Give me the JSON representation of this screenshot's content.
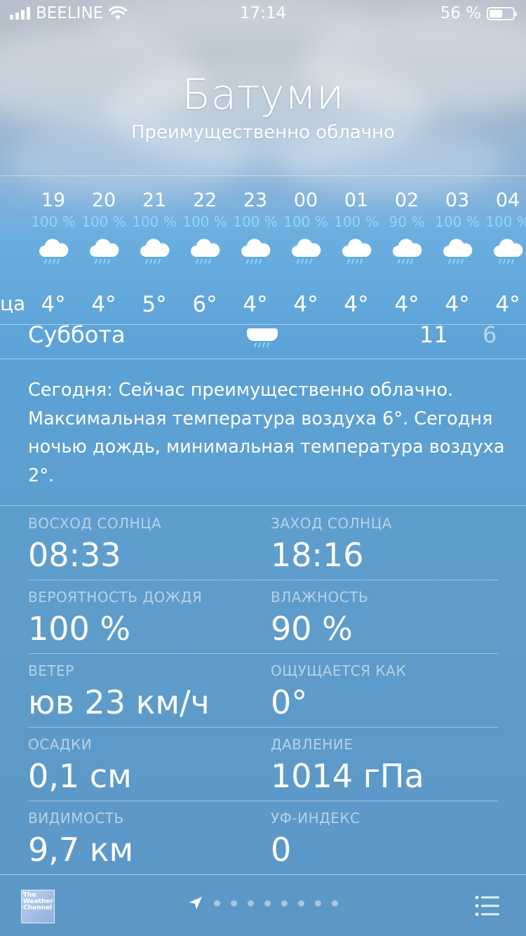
{
  "status_bar": {
    "carrier": "BEELINE",
    "time": "17:14",
    "battery": "56 %"
  },
  "location": {
    "city": "Батуми",
    "condition": "Преимущественно облачно"
  },
  "hourly": [
    {
      "hour": "19",
      "precip": "100 %",
      "temp": "4°",
      "icon": "rain-cloud-icon"
    },
    {
      "hour": "20",
      "precip": "100 %",
      "temp": "4°",
      "icon": "rain-cloud-icon"
    },
    {
      "hour": "21",
      "precip": "100 %",
      "temp": "5°",
      "icon": "rain-cloud-icon"
    },
    {
      "hour": "22",
      "precip": "100 %",
      "temp": "6°",
      "icon": "rain-cloud-icon"
    },
    {
      "hour": "23",
      "precip": "100 %",
      "temp": "4°",
      "icon": "rain-cloud-icon"
    },
    {
      "hour": "00",
      "precip": "100 %",
      "temp": "4°",
      "icon": "rain-cloud-icon"
    },
    {
      "hour": "01",
      "precip": "100 %",
      "temp": "4°",
      "icon": "rain-cloud-icon"
    },
    {
      "hour": "02",
      "precip": "90 %",
      "temp": "4°",
      "icon": "rain-cloud-icon"
    },
    {
      "hour": "03",
      "precip": "100 %",
      "temp": "4°",
      "icon": "rain-cloud-icon"
    },
    {
      "hour": "04",
      "precip": "100 %",
      "temp": "4°",
      "icon": "rain-cloud-icon"
    }
  ],
  "hourly_cut_label": "ца",
  "daily_peek": {
    "day": "Суббота",
    "high": "11",
    "low": "6",
    "icon": "rain-cloud-icon"
  },
  "summary": "Сегодня: Сейчас преимущественно облачно. Максимальная температура воздуха 6°. Сегодня ночью дождь, минимальная температура воздуха 2°.",
  "details": [
    [
      {
        "label": "ВОСХОД СОЛНЦА",
        "value": "08:33"
      },
      {
        "label": "ЗАХОД СОЛНЦА",
        "value": "18:16"
      }
    ],
    [
      {
        "label": "ВЕРОЯТНОСТЬ ДОЖДЯ",
        "value": "100 %"
      },
      {
        "label": "ВЛАЖНОСТЬ",
        "value": "90 %"
      }
    ],
    [
      {
        "label": "ВЕТЕР",
        "value": "юв 23 км/ч"
      },
      {
        "label": "ОЩУЩАЕТСЯ КАК",
        "value": "0°"
      }
    ],
    [
      {
        "label": "ОСАДКИ",
        "value": "0,1 см"
      },
      {
        "label": "ДАВЛЕНИЕ",
        "value": "1014 гПа"
      }
    ],
    [
      {
        "label": "ВИДИМОСТЬ",
        "value": "9,7 км"
      },
      {
        "label": "УФ-ИНДЕКС",
        "value": "0"
      }
    ]
  ],
  "bottom_bar": {
    "logo_text": "The Weather Channel",
    "page_dots": 8
  },
  "colors": {
    "precip_blue": "#8fd6ff"
  }
}
